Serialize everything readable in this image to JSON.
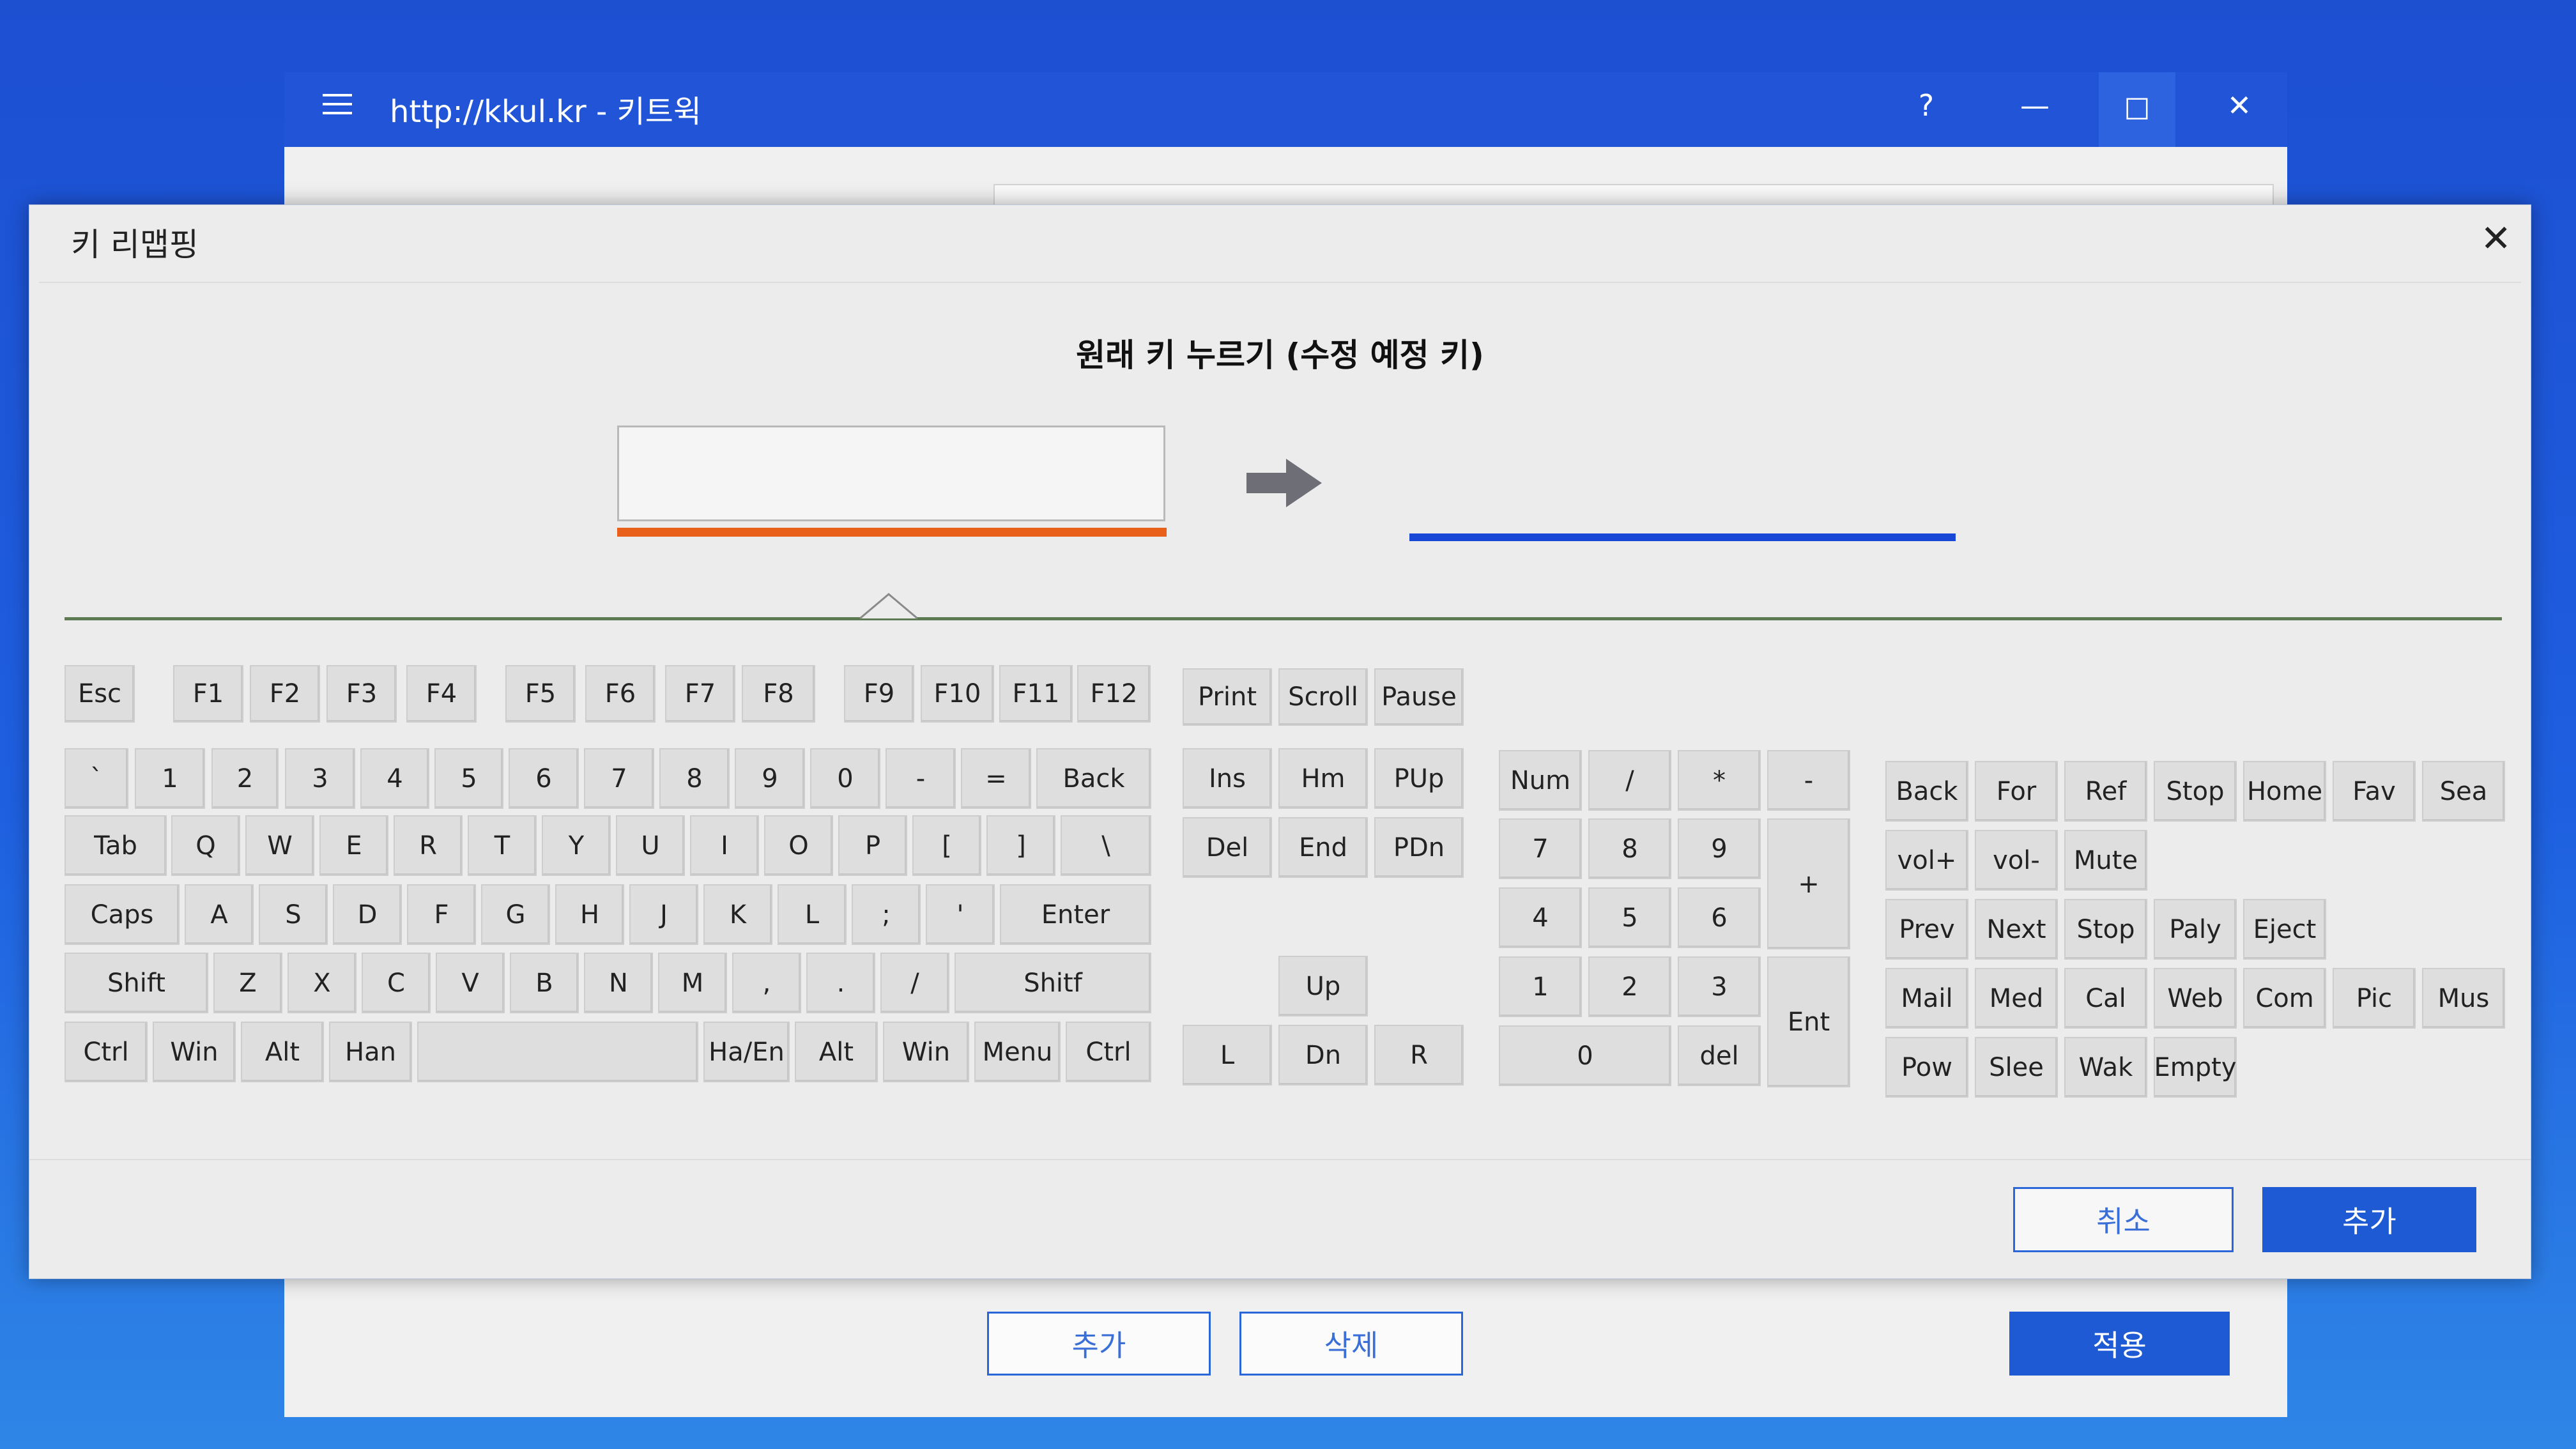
{
  "bg_window": {
    "menu_icon": "hamburger-menu-icon",
    "title": "http://kkul.kr -  키트윅",
    "help": "?",
    "minimize": "—",
    "maximize": "☐",
    "close": "✕",
    "add_btn": "추가",
    "delete_btn": "삭제",
    "apply_btn": "적용"
  },
  "dialog": {
    "title": "키 리맵핑",
    "close": "✕",
    "prompt": "원래 키 누르기 (수정 예정 키)",
    "source_key_value": "",
    "target_key_value": "",
    "cancel_btn": "취소",
    "add_btn": "추가"
  },
  "colors": {
    "source_underline": "#e8601a",
    "target_underline": "#1846d6",
    "accent": "#1d5ad4"
  },
  "keys": {
    "esc": "Esc",
    "f1": "F1",
    "f2": "F2",
    "f3": "F3",
    "f4": "F4",
    "f5": "F5",
    "f6": "F6",
    "f7": "F7",
    "f8": "F8",
    "f9": "F9",
    "f10": "F10",
    "f11": "F11",
    "f12": "F12",
    "print": "Print",
    "scroll": "Scroll",
    "pause": "Pause",
    "grave": "`",
    "d1": "1",
    "d2": "2",
    "d3": "3",
    "d4": "4",
    "d5": "5",
    "d6": "6",
    "d7": "7",
    "d8": "8",
    "d9": "9",
    "d0": "0",
    "minus": "-",
    "equals": "=",
    "back": "Back",
    "tab": "Tab",
    "q": "Q",
    "w": "W",
    "e": "E",
    "r": "R",
    "t": "T",
    "y": "Y",
    "u": "U",
    "i": "I",
    "o": "O",
    "p": "P",
    "lbracket": "[",
    "rbracket": "]",
    "backslash": "\\",
    "caps": "Caps",
    "a": "A",
    "s": "S",
    "d": "D",
    "f": "F",
    "g": "G",
    "h": "H",
    "j": "J",
    "k": "K",
    "l": "L",
    "semicolon": ";",
    "quote": "'",
    "enter": "Enter",
    "lshift": "Shift",
    "z": "Z",
    "x": "X",
    "c": "C",
    "v": "V",
    "b": "B",
    "n": "N",
    "m": "M",
    "comma": ",",
    "period": ".",
    "slash": "/",
    "rshift": "Shitf",
    "lctrl": "Ctrl",
    "lwin": "Win",
    "lalt": "Alt",
    "han": "Han",
    "space": "",
    "haen": "Ha/En",
    "ralt": "Alt",
    "rwin": "Win",
    "menu": "Menu",
    "rctrl": "Ctrl",
    "ins": "Ins",
    "hm": "Hm",
    "pup": "PUp",
    "del": "Del",
    "end": "End",
    "pdn": "PDn",
    "up": "Up",
    "left": "L",
    "down": "Dn",
    "right": "R",
    "num": "Num",
    "np_div": "/",
    "np_mul": "*",
    "np_sub": "-",
    "np7": "7",
    "np8": "8",
    "np9": "9",
    "np_add": "+",
    "np4": "4",
    "np5": "5",
    "np6": "6",
    "np1": "1",
    "np2": "2",
    "np3": "3",
    "np_ent": "Ent",
    "np0": "0",
    "np_del": "del",
    "m_back": "Back",
    "m_for": "For",
    "m_ref": "Ref",
    "m_stop": "Stop",
    "m_home": "Home",
    "m_fav": "Fav",
    "m_sea": "Sea",
    "m_volup": "vol+",
    "m_voldn": "vol-",
    "m_mute": "Mute",
    "m_prev": "Prev",
    "m_next": "Next",
    "m_stop2": "Stop",
    "m_paly": "Paly",
    "m_eject": "Eject",
    "m_mail": "Mail",
    "m_med": "Med",
    "m_cal": "Cal",
    "m_web": "Web",
    "m_com": "Com",
    "m_pic": "Pic",
    "m_mus": "Mus",
    "m_pow": "Pow",
    "m_slee": "Slee",
    "m_wak": "Wak",
    "m_empty": "Empty"
  }
}
